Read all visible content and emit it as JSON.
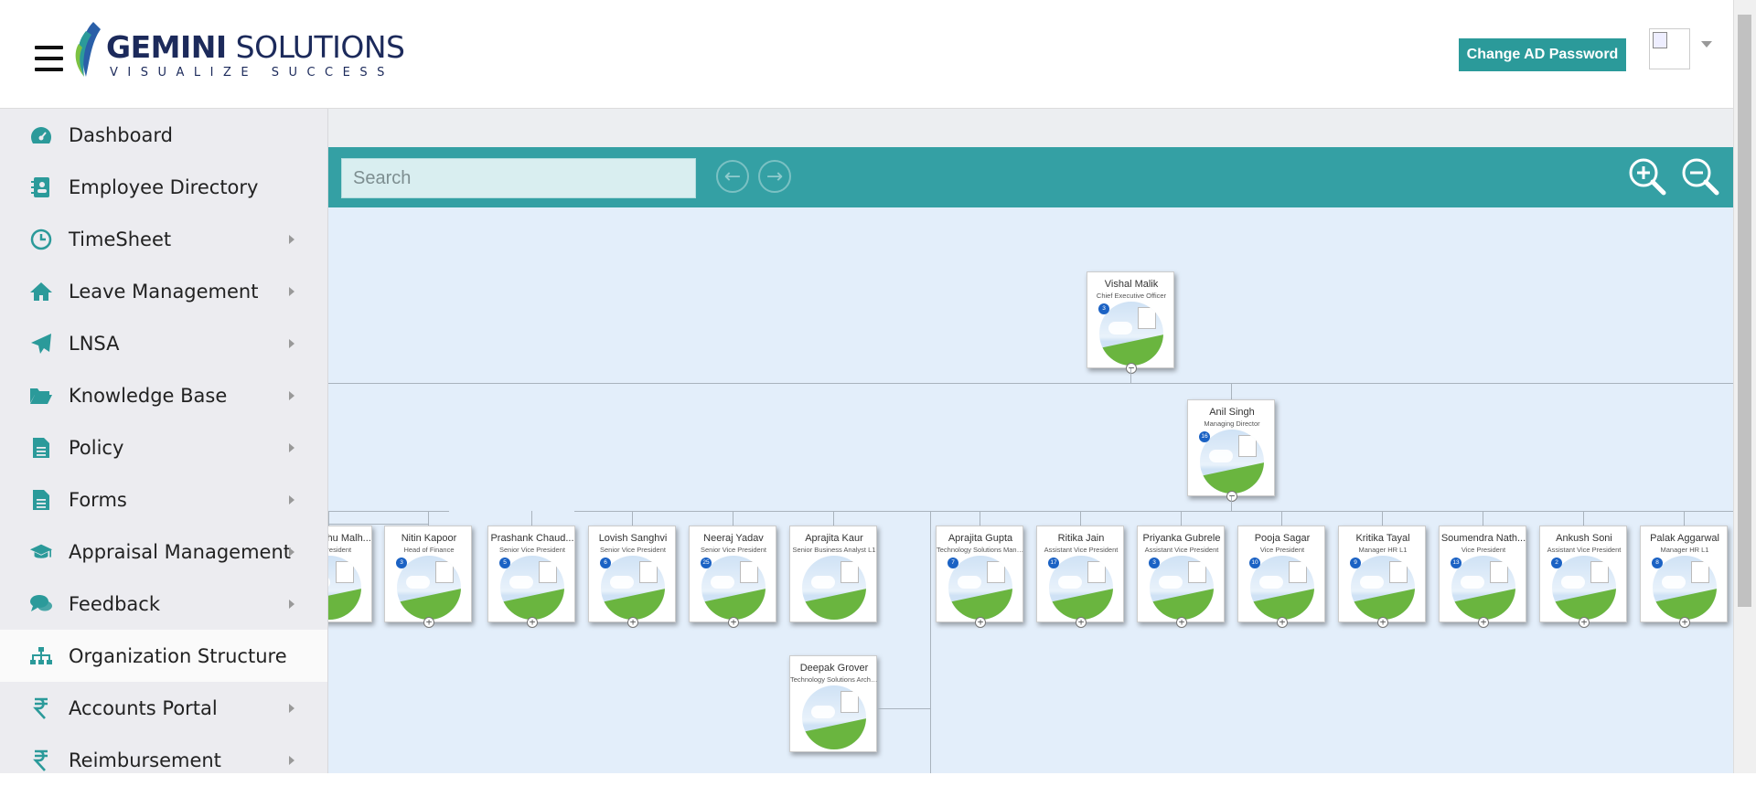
{
  "header": {
    "logo_name_bold": "GEMINI",
    "logo_name_rest": " SOLUTIONS",
    "logo_tagline": "VISUALIZE SUCCESS",
    "change_password_label": "Change AD Password"
  },
  "sidebar": {
    "items": [
      {
        "label": "Dashboard",
        "icon": "dashboard-icon",
        "has_arrow": false
      },
      {
        "label": "Employee Directory",
        "icon": "address-book-icon",
        "has_arrow": false
      },
      {
        "label": "TimeSheet",
        "icon": "clock-icon",
        "has_arrow": true
      },
      {
        "label": "Leave Management",
        "icon": "home-icon",
        "has_arrow": true
      },
      {
        "label": "LNSA",
        "icon": "paper-plane-icon",
        "has_arrow": true
      },
      {
        "label": "Knowledge Base",
        "icon": "folder-open-icon",
        "has_arrow": true
      },
      {
        "label": "Policy",
        "icon": "document-icon",
        "has_arrow": true
      },
      {
        "label": "Forms",
        "icon": "document-icon",
        "has_arrow": true
      },
      {
        "label": "Appraisal Management",
        "icon": "graduation-cap-icon",
        "has_arrow": true
      },
      {
        "label": "Feedback",
        "icon": "comments-icon",
        "has_arrow": true
      },
      {
        "label": "Organization Structure",
        "icon": "sitemap-icon",
        "has_arrow": false,
        "active": true
      },
      {
        "label": "Accounts Portal",
        "icon": "rupee-icon",
        "has_arrow": true
      },
      {
        "label": "Reimbursement",
        "icon": "rupee-icon",
        "has_arrow": true
      }
    ]
  },
  "toolbar": {
    "search_placeholder": "Search"
  },
  "org": {
    "ceo": {
      "name": "Vishal Malik",
      "title": "Chief Executive Officer",
      "count": "3"
    },
    "md": {
      "name": "Anil Singh",
      "title": "Managing Director",
      "count": "16"
    },
    "reports": [
      {
        "name": "Sudhanshu Malh...",
        "title": "Vice President",
        "count": ""
      },
      {
        "name": "Nitin Kapoor",
        "title": "Head of Finance",
        "count": "3"
      },
      {
        "name": "Prashank Chaud...",
        "title": "Senior Vice President",
        "count": "5"
      },
      {
        "name": "Lovish Sanghvi",
        "title": "Senior Vice President",
        "count": "6"
      },
      {
        "name": "Neeraj Yadav",
        "title": "Senior Vice President",
        "count": "25"
      },
      {
        "name": "Aprajita Kaur",
        "title": "Senior Business Analyst L1",
        "count": ""
      },
      {
        "name": "Aprajita Gupta",
        "title": "Technology Solutions Manag...",
        "count": "7"
      },
      {
        "name": "Ritika Jain",
        "title": "Assistant Vice President",
        "count": "17"
      },
      {
        "name": "Priyanka Gubrele",
        "title": "Assistant Vice President",
        "count": "3"
      },
      {
        "name": "Pooja Sagar",
        "title": "Vice President",
        "count": "10"
      },
      {
        "name": "Kritika Tayal",
        "title": "Manager HR L1",
        "count": "9"
      },
      {
        "name": "Soumendra Nath...",
        "title": "Vice President",
        "count": "13"
      },
      {
        "name": "Ankush Soni",
        "title": "Assistant Vice President",
        "count": "2"
      },
      {
        "name": "Palak Aggarwal",
        "title": "Manager HR L1",
        "count": "8"
      }
    ],
    "sub": {
      "name": "Deepak Grover",
      "title": "Technology Solutions Archite...",
      "count": ""
    }
  }
}
